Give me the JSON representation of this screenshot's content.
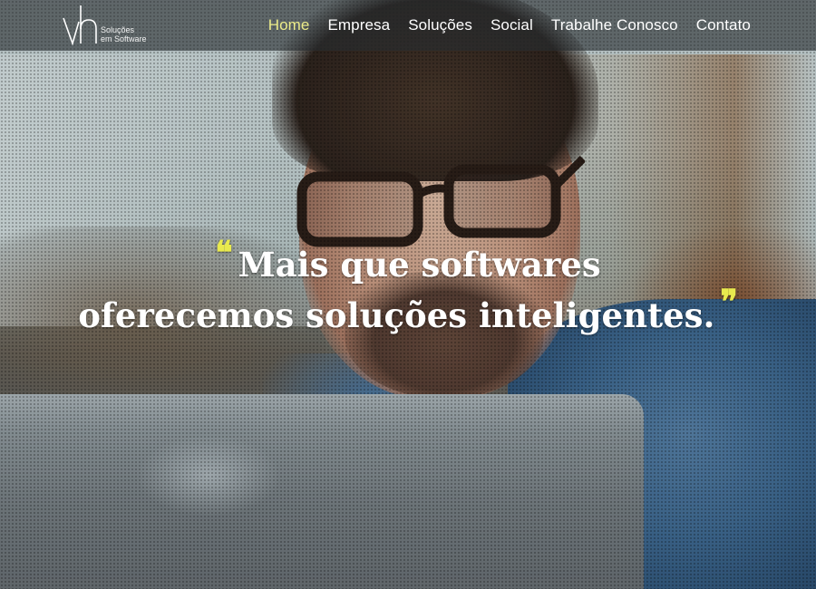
{
  "logo": {
    "mark": "vh",
    "line1": "Soluções",
    "line2": "em Software"
  },
  "nav": [
    {
      "label": "Home",
      "active": true
    },
    {
      "label": "Empresa",
      "active": false
    },
    {
      "label": "Soluções",
      "active": false
    },
    {
      "label": "Social",
      "active": false
    },
    {
      "label": "Trabalhe Conosco",
      "active": false
    },
    {
      "label": "Contato",
      "active": false
    }
  ],
  "hero": {
    "quote_open": "❝",
    "line1": "Mais que softwares",
    "line2": "oferecemos soluções inteligentes.",
    "quote_close": "❞"
  },
  "colors": {
    "nav_active": "#ecec8a",
    "quote_marks": "#e8e94e",
    "header_bg": "rgba(40,45,48,0.62)"
  }
}
